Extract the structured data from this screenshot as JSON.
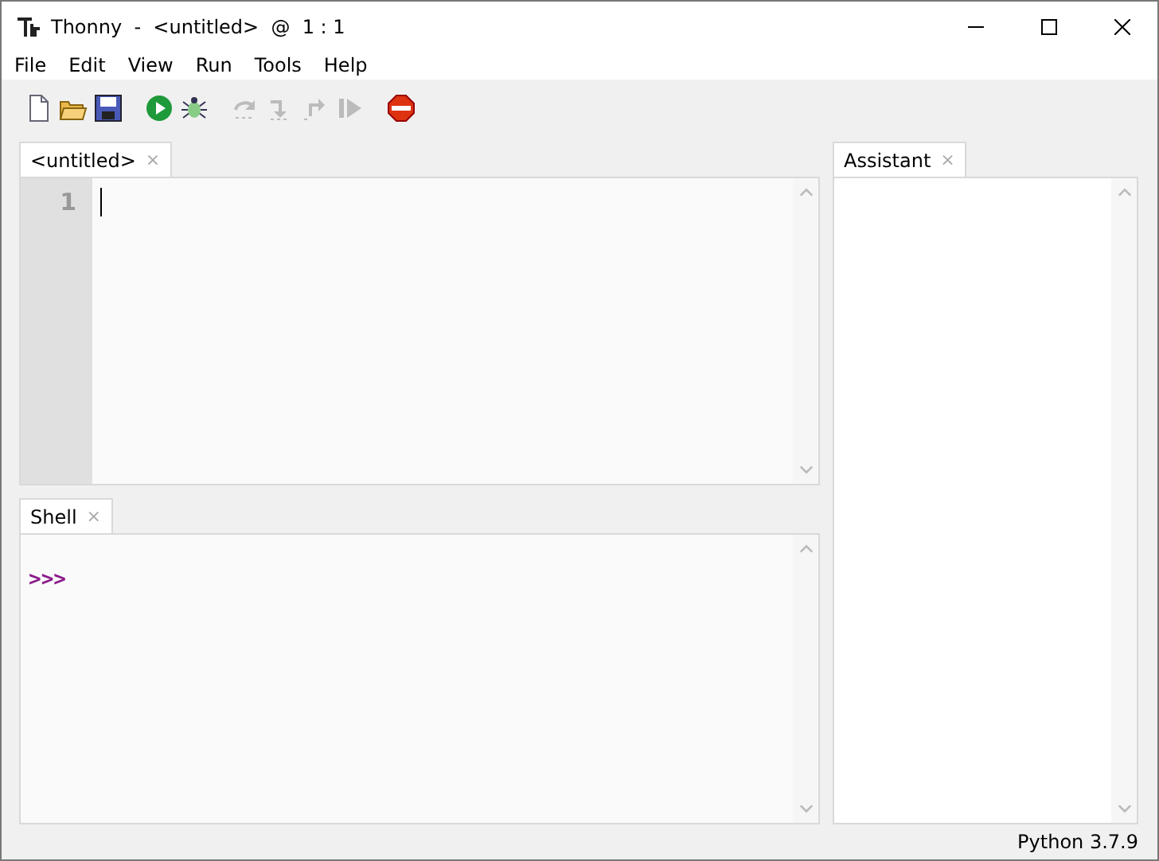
{
  "window": {
    "title": "Thonny  -  <untitled>  @  1 : 1"
  },
  "menu": [
    "File",
    "Edit",
    "View",
    "Run",
    "Tools",
    "Help"
  ],
  "toolbar": [
    {
      "kind": "new",
      "disabled": false
    },
    {
      "kind": "open",
      "disabled": false
    },
    {
      "kind": "save",
      "disabled": false
    },
    {
      "kind": "run",
      "disabled": false
    },
    {
      "kind": "debug",
      "disabled": false
    },
    {
      "kind": "step_over",
      "disabled": true
    },
    {
      "kind": "step_into",
      "disabled": true
    },
    {
      "kind": "step_out",
      "disabled": true
    },
    {
      "kind": "resume",
      "disabled": true
    },
    {
      "kind": "stop",
      "disabled": false
    }
  ],
  "editor": {
    "tab": {
      "label": "<untitled>",
      "close": "×",
      "selected": true
    },
    "line_numbers": [
      "1"
    ]
  },
  "shell": {
    "tab": {
      "label": "Shell",
      "close": "×",
      "selected": true
    },
    "prompt": ">>>"
  },
  "assistant": {
    "tab": {
      "label": "Assistant",
      "close": "×",
      "selected": true
    }
  },
  "status_bar": {
    "text": "Python 3.7.9"
  }
}
